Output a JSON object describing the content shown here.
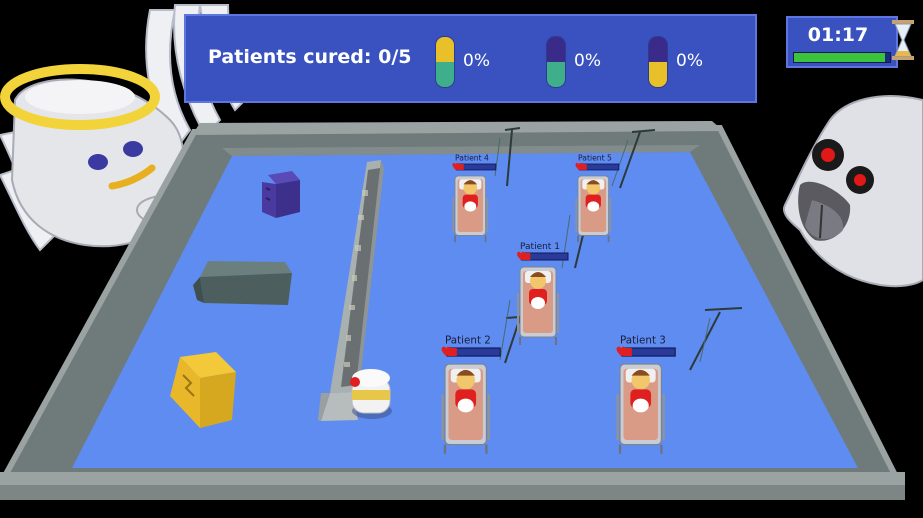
{
  "hud": {
    "patients_cured_label": "Patients cured: 0/5",
    "pills": [
      {
        "name": "yellow-teal-pill",
        "top_color": "#e8c02a",
        "bottom_color": "#3fae8a",
        "percent": "0%"
      },
      {
        "name": "purple-teal-pill",
        "top_color": "#3a2a8a",
        "bottom_color": "#3fae8a",
        "percent": "0%"
      },
      {
        "name": "purple-yellow-pill",
        "top_color": "#3a2a8a",
        "bottom_color": "#e8c02a",
        "percent": "0%"
      }
    ]
  },
  "timer": {
    "time": "01:17",
    "remaining_fraction": 0.95
  },
  "patients": [
    {
      "label": "Patient 1",
      "health_fraction": 0.18
    },
    {
      "label": "Patient 2",
      "health_fraction": 0.18
    },
    {
      "label": "Patient 3",
      "health_fraction": 0.18
    },
    {
      "label": "Patient 4",
      "health_fraction": 0.18
    },
    {
      "label": "Patient 5",
      "health_fraction": 0.18
    }
  ],
  "colors": {
    "hud_blue": "#3a52c0",
    "floor_blue": "#5f8cf0",
    "wall_grey": "#6f7a7a",
    "health_red": "#e02020",
    "timer_green": "#3bc43b"
  }
}
